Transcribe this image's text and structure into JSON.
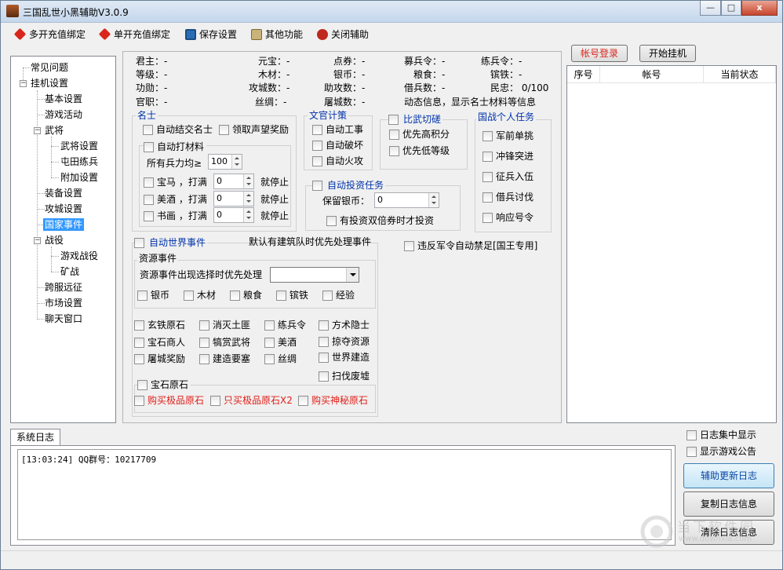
{
  "window": {
    "title": "三国乱世小黑辅助V3.0.9",
    "min": "—",
    "max": "□",
    "close": "x"
  },
  "toolbar": [
    {
      "label": "多开充值绑定",
      "icon": "red-gem-icon",
      "color": "#d9261c"
    },
    {
      "label": "单开充值绑定",
      "icon": "red-gem-icon",
      "color": "#d9261c"
    },
    {
      "label": "保存设置",
      "icon": "floppy-disk-icon",
      "color": "#2a6db5"
    },
    {
      "label": "其他功能",
      "icon": "tools-icon",
      "color": "#7a6a3a"
    },
    {
      "label": "关闭辅助",
      "icon": "power-icon",
      "color": "#c0281c"
    }
  ],
  "tree": [
    {
      "label": "常见问题"
    },
    {
      "label": "挂机设置"
    },
    {
      "label": "基本设置"
    },
    {
      "label": "游戏活动"
    },
    {
      "label": "武将"
    },
    {
      "label": "武将设置"
    },
    {
      "label": "屯田练兵"
    },
    {
      "label": "附加设置"
    },
    {
      "label": "装备设置"
    },
    {
      "label": "攻城设置"
    },
    {
      "label": "国家事件"
    },
    {
      "label": "战役"
    },
    {
      "label": "游戏战役"
    },
    {
      "label": "矿战"
    },
    {
      "label": "跨服远征"
    },
    {
      "label": "市场设置"
    },
    {
      "label": "聊天窗口"
    }
  ],
  "tree_expand": {
    "minus": "−"
  },
  "info": {
    "junzhu": "君主：-",
    "yuanbao": "元宝：-",
    "dianquan": "点券：-",
    "muyingling": "募兵令：-",
    "lianbingling": "练兵令：-",
    "dengji": "等级：-",
    "mucai": "木材：-",
    "yinbi": "银币：-",
    "liangshi": "粮食：-",
    "bintie": "镔铁：-",
    "gongxun": "功勋：-",
    "gonggongshu": "攻城数：-",
    "zhugongshu": "助攻数：-",
    "jiebingshu": "借兵数：-",
    "minzhong": "民忠： 0/100",
    "guanzhi": "官职：-",
    "sichou": "丝绸：-",
    "tuchengshu": "屠城数：-",
    "dongtai": "动态信息，显示名士材料等信息"
  },
  "mingshi": {
    "legend": "名士",
    "auto_submit": "自动结交名士",
    "fame_reward": "领取声望奖励",
    "auto_material": "自动打材料",
    "all_troops": "所有兵力均≥",
    "troops_value": "100",
    "items": [
      {
        "label": "宝马 ，打满",
        "value": "0",
        "stop": "就停止"
      },
      {
        "label": "美酒 ，打满",
        "value": "0",
        "stop": "就停止"
      },
      {
        "label": "书画 ，打满",
        "value": "0",
        "stop": "就停止"
      }
    ]
  },
  "wenguan": {
    "legend": "文官计策",
    "items": [
      "自动工事",
      "自动破坏",
      "自动火攻"
    ]
  },
  "biwu": {
    "legend": "比武切磋",
    "items": [
      "优先高积分",
      "优先低等级"
    ]
  },
  "guozhan": {
    "legend": "国战个人任务",
    "items": [
      "军前单挑",
      "冲锋突进",
      "征兵入伍",
      "借兵讨伐",
      "响应号令"
    ]
  },
  "touzi": {
    "legend": "自动投资任务",
    "keep_label": "保留银币：",
    "keep_value": "0",
    "double": "有投资双倍券时才投资"
  },
  "anti_ban": "违反军令自动禁足[国王专用]",
  "world": {
    "auto_event": "自动世界事件",
    "note": "默认有建筑队时优先处理事件",
    "resource_legend": "资源事件",
    "priority_label": "资源事件出现选择时优先处理",
    "priority_value": "",
    "resources": [
      "银币",
      "木材",
      "粮食",
      "镔铁",
      "经验"
    ],
    "events": [
      "玄铁原石",
      "消灭土匪",
      "练兵令",
      "方术隐士",
      "宝石商人",
      "犒赏武将",
      "美酒",
      "掠夺资源",
      "屠城奖励",
      "建造要塞",
      "丝绸",
      "世界建造",
      "扫伐废墟"
    ],
    "gem_legend": "宝石原石",
    "gems": [
      "购买极品原石",
      "只买极品原石X2",
      "购买神秘原石"
    ]
  },
  "account": {
    "login_button": "帐号登录",
    "start_button": "开始挂机",
    "columns": [
      "序号",
      "帐号",
      "当前状态"
    ]
  },
  "log": {
    "tab": "系统日志",
    "lines": [
      "[13:03:24] QQ群号：10217709"
    ],
    "centralize": "日志集中显示",
    "show_notice": "显示游戏公告",
    "update_button": "辅助更新日志",
    "copy_button": "复制日志信息",
    "clear_button": "清除日志信息"
  },
  "watermark": {
    "text": "当下软件园",
    "url": "www.downxia.com"
  }
}
